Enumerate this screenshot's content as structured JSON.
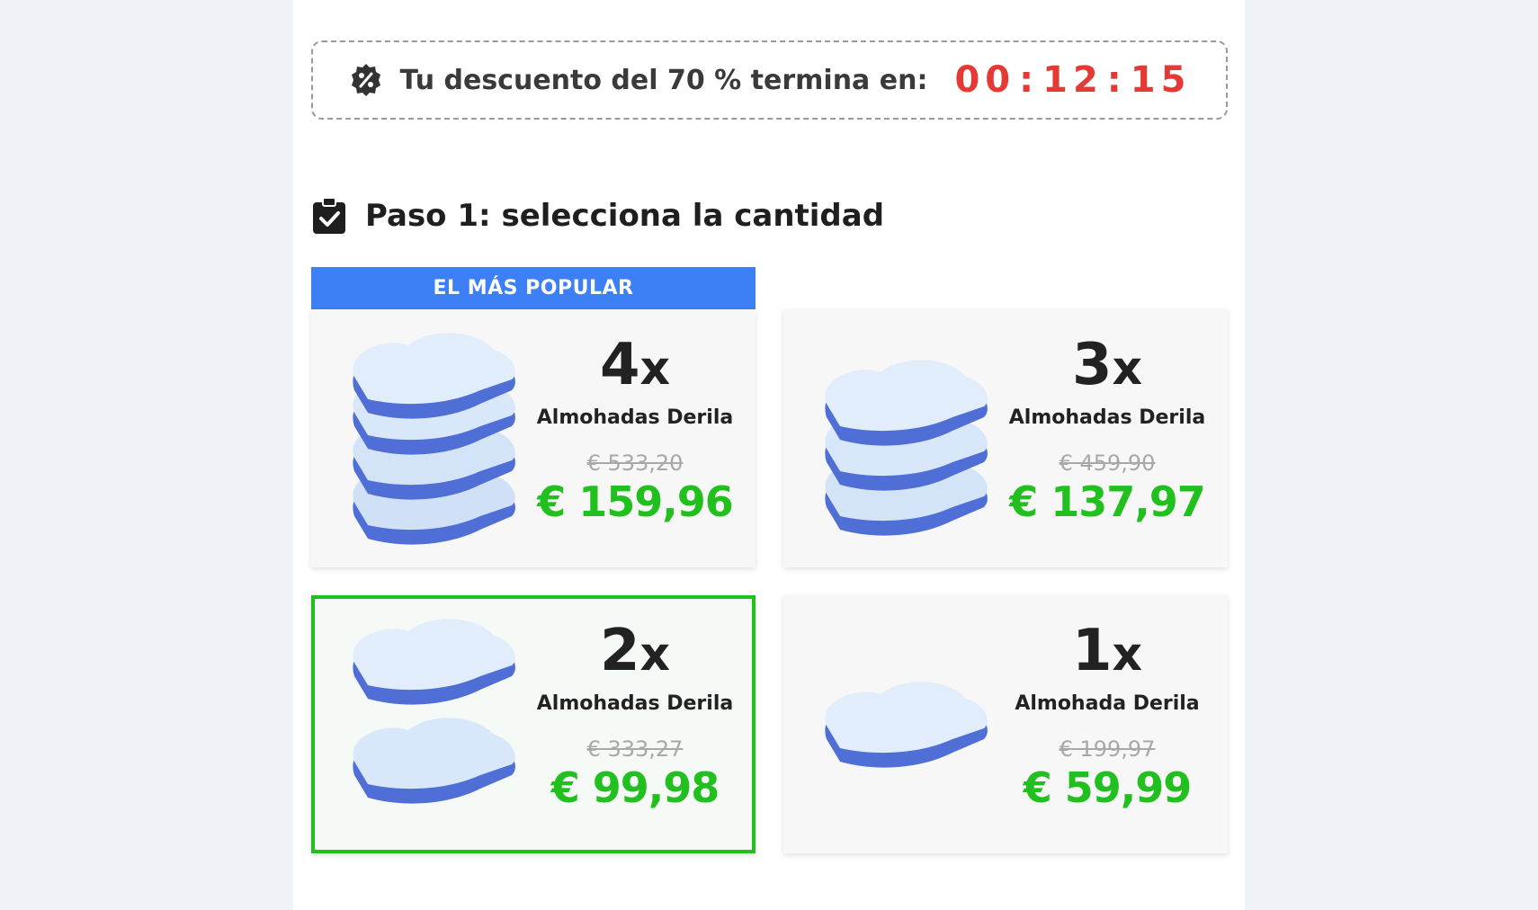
{
  "timer": {
    "label": "Tu descuento del 70 % termina en:",
    "hours": "00",
    "minutes": "12",
    "seconds": "15",
    "color": "#e53935"
  },
  "step": {
    "title": "Paso 1: selecciona la cantidad"
  },
  "popular_badge": "EL MÁS POPULAR",
  "options": [
    {
      "qty": "4",
      "x": "x",
      "name": "Almohadas Derila",
      "old_price": "€ 533,20",
      "new_price": "€ 159,96",
      "selected": false,
      "popular": true
    },
    {
      "qty": "3",
      "x": "x",
      "name": "Almohadas Derila",
      "old_price": "€ 459,90",
      "new_price": "€ 137,97",
      "selected": false,
      "popular": false
    },
    {
      "qty": "2",
      "x": "x",
      "name": "Almohadas Derila",
      "old_price": "€ 333,27",
      "new_price": "€ 99,98",
      "selected": true,
      "popular": false
    },
    {
      "qty": "1",
      "x": "x",
      "name": "Almohada Derila",
      "old_price": "€ 199,97",
      "new_price": "€ 59,99",
      "selected": false,
      "popular": false
    }
  ],
  "colors": {
    "accent_green": "#22c01e",
    "banner_blue": "#3d7ff5",
    "timer_red": "#e53935"
  },
  "icons": [
    "discount-badge-icon",
    "clipboard-check-icon"
  ]
}
